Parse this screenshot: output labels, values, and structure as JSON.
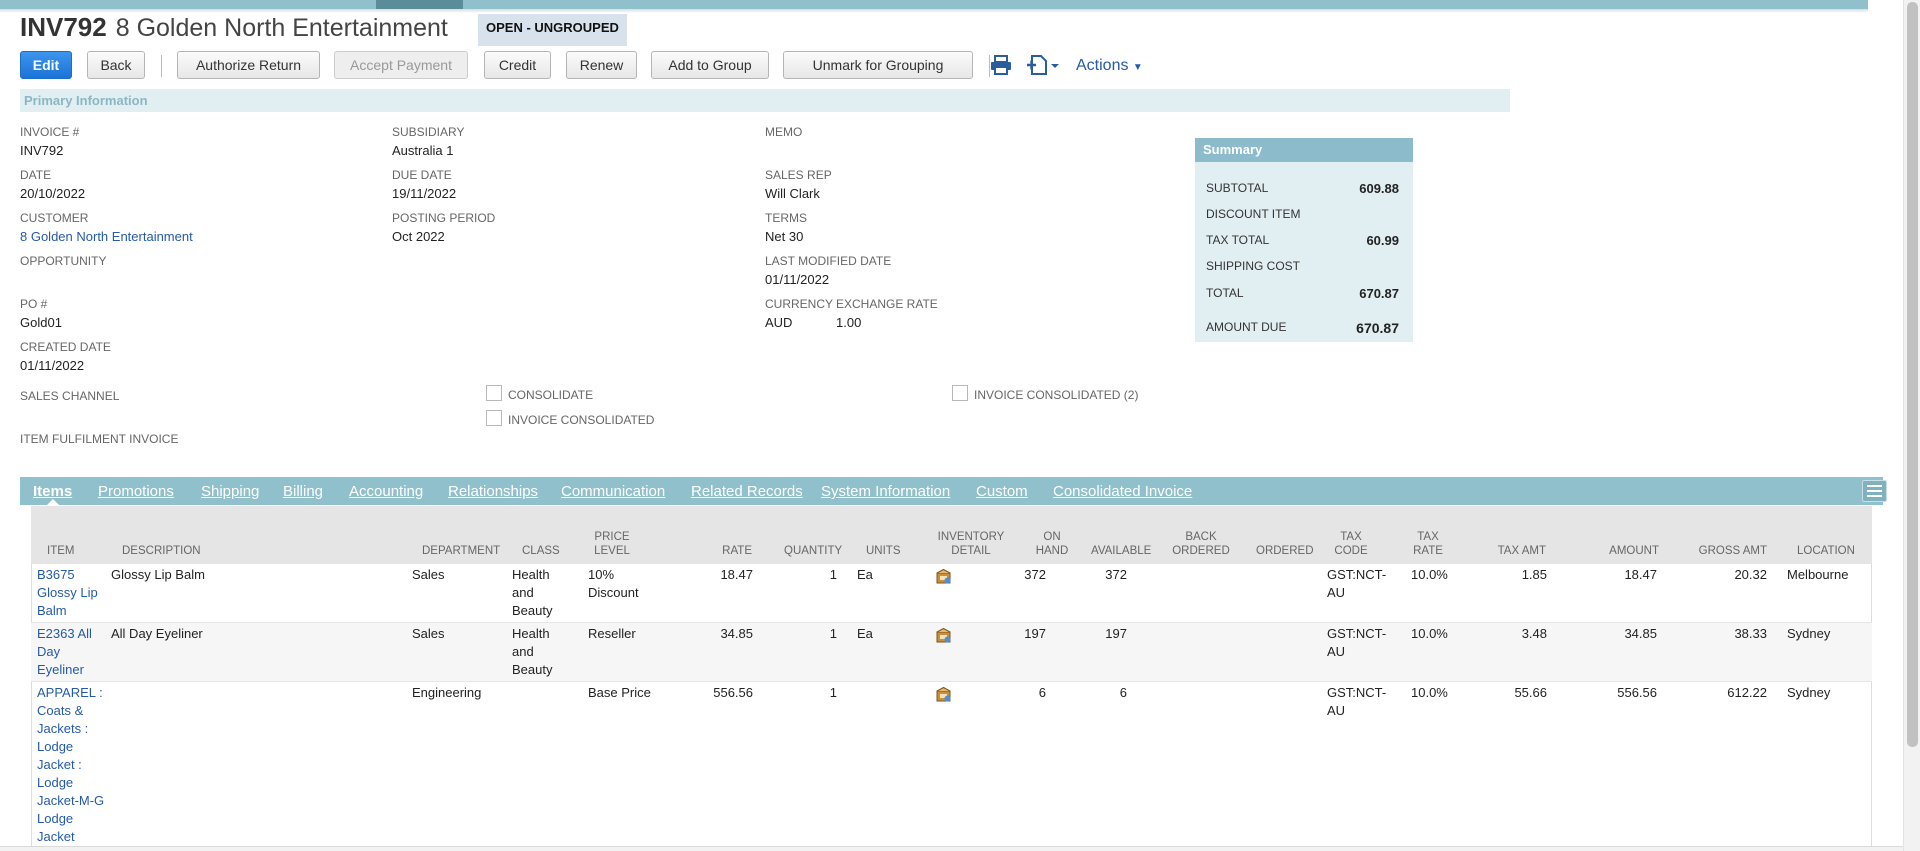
{
  "header": {
    "record_number": "INV792",
    "customer_name": "8 Golden North Entertainment",
    "status": "OPEN - UNGROUPED"
  },
  "toolbar": {
    "edit": "Edit",
    "back": "Back",
    "authorize_return": "Authorize Return",
    "accept_payment": "Accept Payment",
    "credit": "Credit",
    "renew": "Renew",
    "add_to_group": "Add to Group",
    "unmark_for_grouping": "Unmark for Grouping",
    "actions": "Actions"
  },
  "primary": {
    "section_title": "Primary Information",
    "invoice_num_label": "INVOICE #",
    "invoice_num": "INV792",
    "date_label": "DATE",
    "date": "20/10/2022",
    "customer_label": "CUSTOMER",
    "customer": "8 Golden North Entertainment",
    "opportunity_label": "OPPORTUNITY",
    "po_label": "PO #",
    "po": "Gold01",
    "created_label": "CREATED DATE",
    "created": "01/11/2022",
    "subsidiary_label": "SUBSIDIARY",
    "subsidiary": "Australia 1",
    "due_label": "DUE DATE",
    "due": "19/11/2022",
    "period_label": "POSTING PERIOD",
    "period": "Oct 2022",
    "memo_label": "MEMO",
    "rep_label": "SALES REP",
    "rep": "Will Clark",
    "terms_label": "TERMS",
    "terms": "Net 30",
    "modified_label": "LAST MODIFIED DATE",
    "modified": "01/11/2022",
    "currency_label": "CURRENCY",
    "currency": "AUD",
    "rate_label": "EXCHANGE RATE",
    "rate": "1.00",
    "sales_channel_label": "SALES CHANNEL",
    "fulfilment_label": "ITEM FULFILMENT INVOICE",
    "consolidate_label": "CONSOLIDATE",
    "invoice_consolidated_label": "INVOICE CONSOLIDATED",
    "invoice_consolidated2_label": "INVOICE CONSOLIDATED (2)"
  },
  "summary": {
    "title": "Summary",
    "subtotal_label": "SUBTOTAL",
    "subtotal": "609.88",
    "discount_label": "DISCOUNT ITEM",
    "tax_label": "TAX TOTAL",
    "tax": "60.99",
    "shipping_label": "SHIPPING COST",
    "total_label": "TOTAL",
    "total": "670.87",
    "due_label": "AMOUNT DUE",
    "due": "670.87"
  },
  "tabs": [
    "Items",
    "Promotions",
    "Shipping",
    "Billing",
    "Accounting",
    "Relationships",
    "Communication",
    "Related Records",
    "System Information",
    "Custom",
    "Consolidated Invoice"
  ],
  "items": {
    "columns": {
      "item": "ITEM",
      "description": "DESCRIPTION",
      "department": "DEPARTMENT",
      "class": "CLASS",
      "price_level_1": "PRICE",
      "price_level_2": "LEVEL",
      "rate": "RATE",
      "quantity": "QUANTITY",
      "units": "UNITS",
      "inv_detail_1": "INVENTORY",
      "inv_detail_2": "DETAIL",
      "on_hand_1": "ON",
      "on_hand_2": "HAND",
      "available": "AVAILABLE",
      "back_ordered_1": "BACK",
      "back_ordered_2": "ORDERED",
      "ordered": "ORDERED",
      "tax_code_1": "TAX",
      "tax_code_2": "CODE",
      "tax_rate_1": "TAX",
      "tax_rate_2": "RATE",
      "tax_amt": "TAX AMT",
      "amount": "AMOUNT",
      "gross_amt": "GROSS AMT",
      "location": "LOCATION"
    },
    "rows": [
      {
        "item": [
          "B3675",
          "Glossy Lip",
          "Balm"
        ],
        "description": "Glossy Lip Balm",
        "department": "Sales",
        "class": [
          "Health",
          "and",
          "Beauty"
        ],
        "price_level": [
          "10%",
          "Discount"
        ],
        "rate": "18.47",
        "quantity": "1",
        "units": "Ea",
        "on_hand": "372",
        "available": "372",
        "tax_code": [
          "GST:NCT-",
          "AU"
        ],
        "tax_rate": "10.0%",
        "tax_amt": "1.85",
        "amount": "18.47",
        "gross_amt": "20.32",
        "location": "Melbourne"
      },
      {
        "item": [
          "E2363 All",
          "Day",
          "Eyeliner"
        ],
        "description": "All Day Eyeliner",
        "department": "Sales",
        "class": [
          "Health",
          "and",
          "Beauty"
        ],
        "price_level": [
          "Reseller"
        ],
        "rate": "34.85",
        "quantity": "1",
        "units": "Ea",
        "on_hand": "197",
        "available": "197",
        "tax_code": [
          "GST:NCT-",
          "AU"
        ],
        "tax_rate": "10.0%",
        "tax_amt": "3.48",
        "amount": "34.85",
        "gross_amt": "38.33",
        "location": "Sydney"
      },
      {
        "item": [
          "APPAREL :",
          "Coats &",
          "Jackets :",
          "Lodge",
          "Jacket :",
          "Lodge",
          "Jacket-M-G",
          "Lodge",
          "Jacket"
        ],
        "description": "",
        "department": "Engineering",
        "class": [],
        "price_level": [
          "Base Price"
        ],
        "rate": "556.56",
        "quantity": "1",
        "units": "",
        "on_hand": "6",
        "available": "6",
        "tax_code": [
          "GST:NCT-",
          "AU"
        ],
        "tax_rate": "10.0%",
        "tax_amt": "55.66",
        "amount": "556.56",
        "gross_amt": "612.22",
        "location": "Sydney"
      }
    ]
  }
}
